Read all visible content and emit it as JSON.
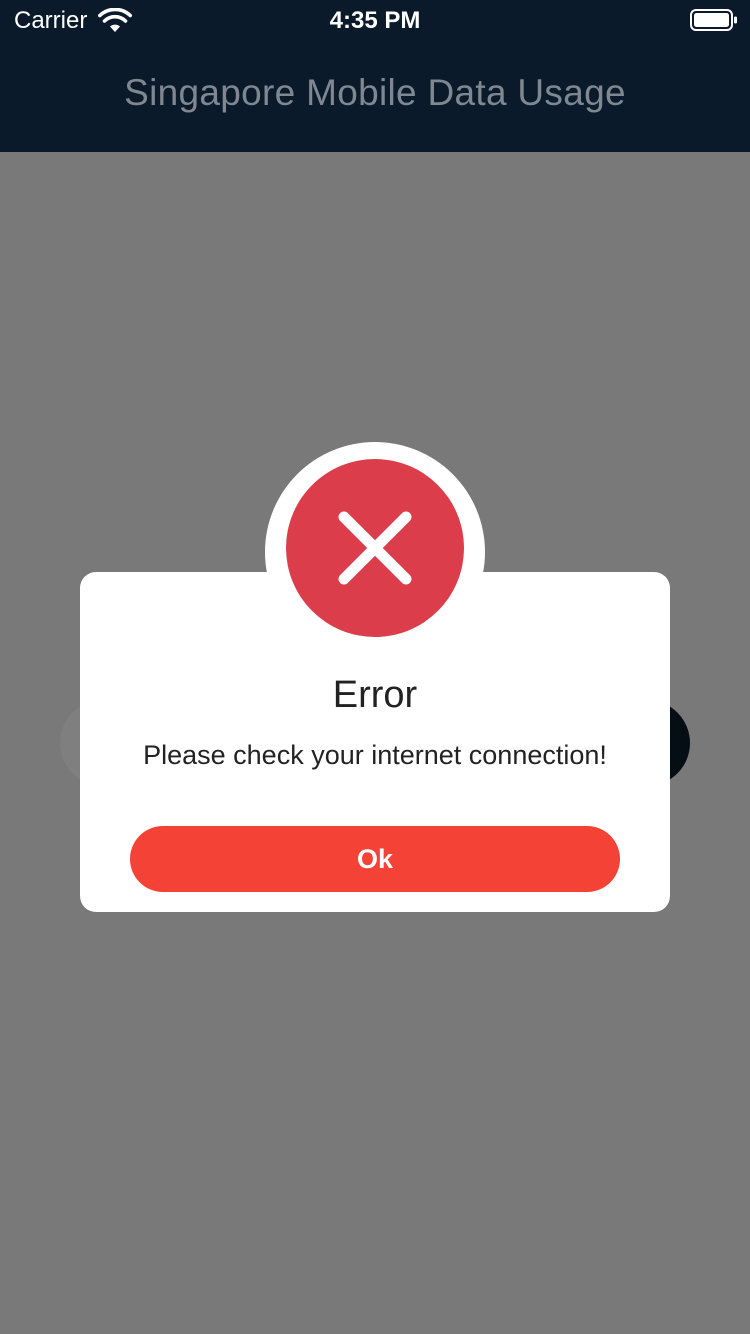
{
  "status_bar": {
    "carrier": "Carrier",
    "time": "4:35 PM",
    "wifi_icon": "wifi-icon",
    "battery_icon": "battery-full-icon"
  },
  "header": {
    "title": "Singapore Mobile Data Usage",
    "background": "#0b1a2b"
  },
  "dialog": {
    "icon": "close-icon",
    "icon_color": "#db3d4a",
    "title": "Error",
    "message": "Please check your internet connection!",
    "ok_label": "Ok",
    "ok_color": "#f44336"
  }
}
